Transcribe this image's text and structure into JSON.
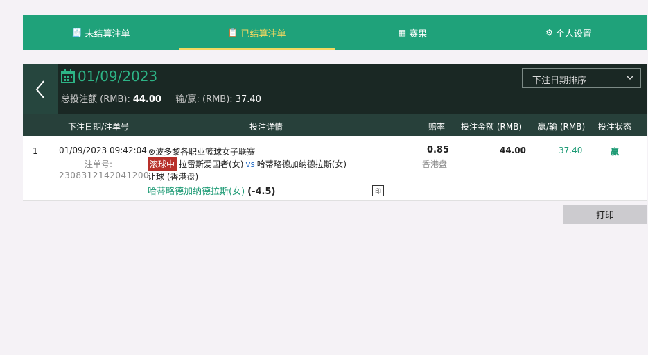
{
  "tabs": [
    {
      "icon": "receipt-icon",
      "glyph": "🧾",
      "label": "未结算注单"
    },
    {
      "icon": "checklist-icon",
      "glyph": "📋",
      "label": "已结算注单"
    },
    {
      "icon": "scoreboard-icon",
      "glyph": "▦",
      "label": "赛果"
    },
    {
      "icon": "gear-icon",
      "glyph": "⚙",
      "label": "个人设置"
    }
  ],
  "header": {
    "date": "01/09/2023",
    "total_label": "总投注额 (RMB):",
    "total_value": "44.00",
    "winloss_label": "输/赢: (RMB):",
    "winloss_value": "37.40",
    "sort_selected": "下注日期排序"
  },
  "columns": [
    "下注日期/注单号",
    "投注详情",
    "赔率",
    "投注金额 (RMB)",
    "赢/输 (RMB)",
    "投注状态"
  ],
  "bet": {
    "index": "1",
    "datetime": "01/09/2023 09:42:04",
    "order_label": "注单号:",
    "order_no": "2308312142041200",
    "league": "波多黎各职业篮球女子联赛",
    "live_badge": "滚球中",
    "home": "拉雷斯爱国者(女)",
    "vs": "vs",
    "away": "哈蒂略德加纳德拉斯(女)",
    "market": "让球 (香港盘)",
    "pick_team": "哈蒂略德加纳德拉斯(女)",
    "pick_handicap": "(-4.5)",
    "odds": "0.85",
    "odds_type": "香港盘",
    "stake": "44.00",
    "winloss": "37.40",
    "status": "赢"
  },
  "print_label": "打印",
  "colors": {
    "brand": "#1fa27a",
    "active": "#f4d860",
    "header_bg": "#1a2824",
    "live": "#b8302a"
  }
}
